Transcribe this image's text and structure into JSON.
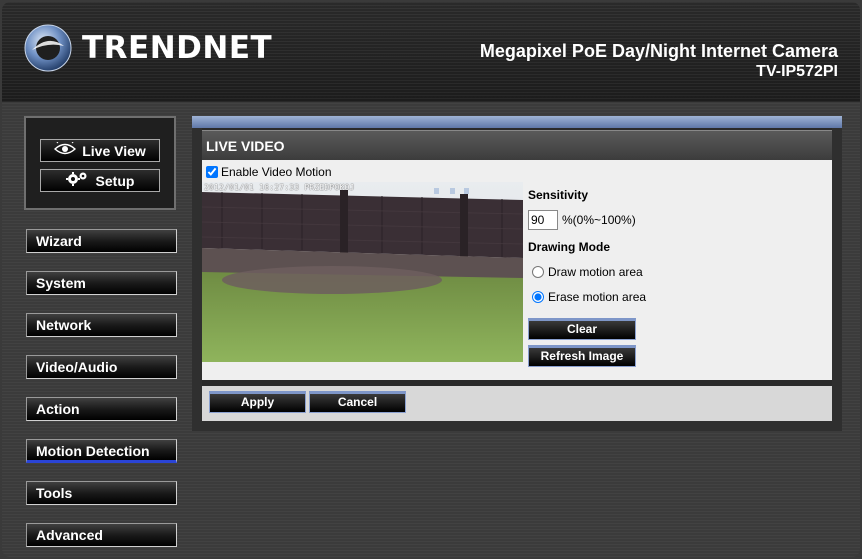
{
  "brand": {
    "name": "TRENDNET",
    "icon": "trendnet-logo-icon"
  },
  "header": {
    "product_title": "Megapixel PoE Day/Night Internet Camera",
    "model": "TV-IP572PI"
  },
  "view_buttons": {
    "live_view": {
      "label": "Live View",
      "icon": "eye-icon"
    },
    "setup": {
      "label": "Setup",
      "icon": "gears-icon"
    }
  },
  "menu": {
    "items": [
      {
        "label": "Wizard"
      },
      {
        "label": "System"
      },
      {
        "label": "Network"
      },
      {
        "label": "Video/Audio"
      },
      {
        "label": "Action"
      },
      {
        "label": "Motion Detection",
        "active": true
      },
      {
        "label": "Tools"
      },
      {
        "label": "Advanced"
      }
    ]
  },
  "section": {
    "title": "LIVE VIDEO",
    "enable_motion_label": "Enable Video Motion",
    "enable_motion_checked": true,
    "video_overlay": "2012/01/01 16:27:33 PRZEDPOKOJ"
  },
  "controls": {
    "sensitivity_label": "Sensitivity",
    "sensitivity_value": "90",
    "sensitivity_range": "%(0%~100%)",
    "drawing_mode_label": "Drawing Mode",
    "draw_label": "Draw motion area",
    "erase_label": "Erase motion area",
    "selected_mode": "erase",
    "clear_label": "Clear",
    "refresh_label": "Refresh Image"
  },
  "footer": {
    "apply_label": "Apply",
    "cancel_label": "Cancel"
  },
  "colors": {
    "accent_blue": "#2a44d6",
    "panel_bar": "#7e96c8"
  }
}
